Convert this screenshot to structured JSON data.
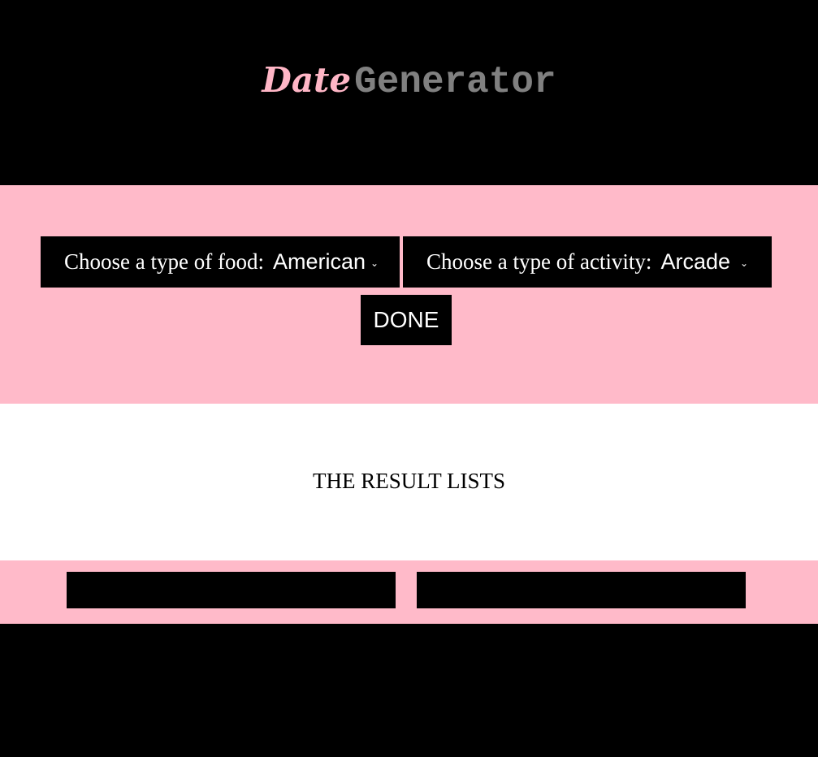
{
  "header": {
    "title_part1": "Date",
    "title_part2": "Generator"
  },
  "controls": {
    "food_label": "Choose a type of food:",
    "food_selected": "American",
    "activity_label": "Choose a type of activity:",
    "activity_selected": "Arcade",
    "done_label": "DONE"
  },
  "results": {
    "title": "THE RESULT LISTS"
  },
  "colors": {
    "background": "#000000",
    "pink_accent": "#ffbac9",
    "title_pink": "#ffb6c6",
    "title_gray": "#808080"
  },
  "icons": {
    "select_arrow": "chevron-down-icon"
  }
}
